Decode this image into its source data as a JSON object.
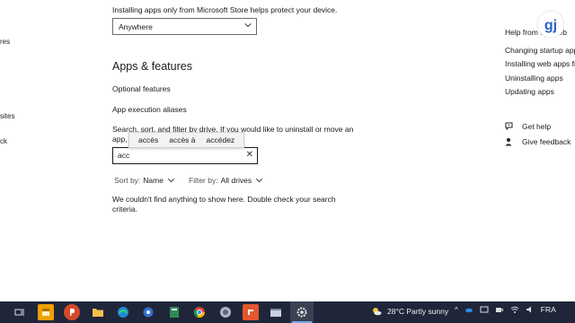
{
  "left_nav": {
    "items": [
      "res",
      "sites",
      "ck"
    ]
  },
  "main": {
    "store_notice": "Installing apps only from Microsoft Store helps protect your device.",
    "source_dropdown_value": "Anywhere",
    "section_title": "Apps & features",
    "optional_features": "Optional features",
    "execution_aliases": "App execution aliases",
    "search_description_line1": "Search, sort, and filter by drive. If you would like to uninstall or move an",
    "search_description_line2": "app, select it from the list.",
    "search_value": "acc",
    "suggestions": [
      "accès",
      "accès à",
      "accédez"
    ],
    "sort_label": "Sort by:",
    "sort_value": "Name",
    "filter_label": "Filter by:",
    "filter_value": "All drives",
    "empty_message_line1": "We couldn't find anything to show here. Double check your search",
    "empty_message_line2": "criteria."
  },
  "right_panel": {
    "help_title": "Help from the web",
    "links": [
      "Changing startup apps",
      "Installing web apps from",
      "Uninstalling apps",
      "Updating apps"
    ],
    "get_help": "Get help",
    "give_feedback": "Give feedback"
  },
  "logo_text": "gj",
  "taskbar": {
    "weather": "28°C  Partly sunny",
    "language": "FRA",
    "icons": [
      "task-view-icon",
      "file-explorer-icon",
      "app-p-icon",
      "folder-icon",
      "edge-icon",
      "network-icon",
      "photos-icon",
      "chrome-icon",
      "app-circle-icon",
      "app-orange-icon",
      "app-window-icon",
      "settings-icon"
    ],
    "colors": {
      "background": "#20263a",
      "accent": "#f0a000"
    }
  }
}
